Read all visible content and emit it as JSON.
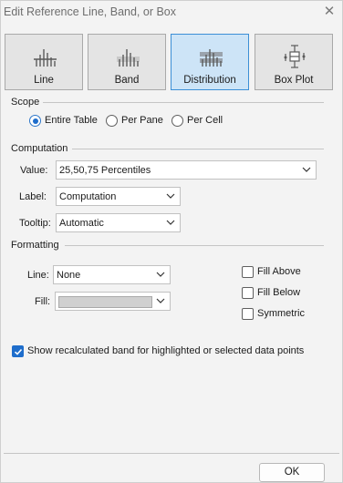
{
  "title": "Edit Reference Line, Band, or Box",
  "type_buttons": [
    {
      "label": "Line",
      "icon": "line-type-icon",
      "selected": false
    },
    {
      "label": "Band",
      "icon": "band-type-icon",
      "selected": false
    },
    {
      "label": "Distribution",
      "icon": "distribution-type-icon",
      "selected": true
    },
    {
      "label": "Box Plot",
      "icon": "box-plot-type-icon",
      "selected": false
    }
  ],
  "scope": {
    "title": "Scope",
    "options": [
      {
        "label": "Entire Table",
        "checked": true
      },
      {
        "label": "Per Pane",
        "checked": false
      },
      {
        "label": "Per Cell",
        "checked": false
      }
    ]
  },
  "computation": {
    "title": "Computation",
    "value_label": "Value:",
    "value": "25,50,75 Percentiles",
    "label_label": "Label:",
    "label_value": "Computation",
    "tooltip_label": "Tooltip:",
    "tooltip_value": "Automatic"
  },
  "formatting": {
    "title": "Formatting",
    "line_label": "Line:",
    "line_value": "None",
    "fill_label": "Fill:",
    "fill_color": "#d0d0d0",
    "fill_above": {
      "label": "Fill Above",
      "checked": false
    },
    "fill_below": {
      "label": "Fill Below",
      "checked": false
    },
    "symmetric": {
      "label": "Symmetric",
      "checked": false
    }
  },
  "recalc": {
    "label": "Show recalculated band for highlighted or selected data points",
    "checked": true
  },
  "ok_label": "OK",
  "colors": {
    "accent": "#1e6dcb",
    "selected_bg": "#cde4f7",
    "selected_border": "#3c8fd6"
  }
}
